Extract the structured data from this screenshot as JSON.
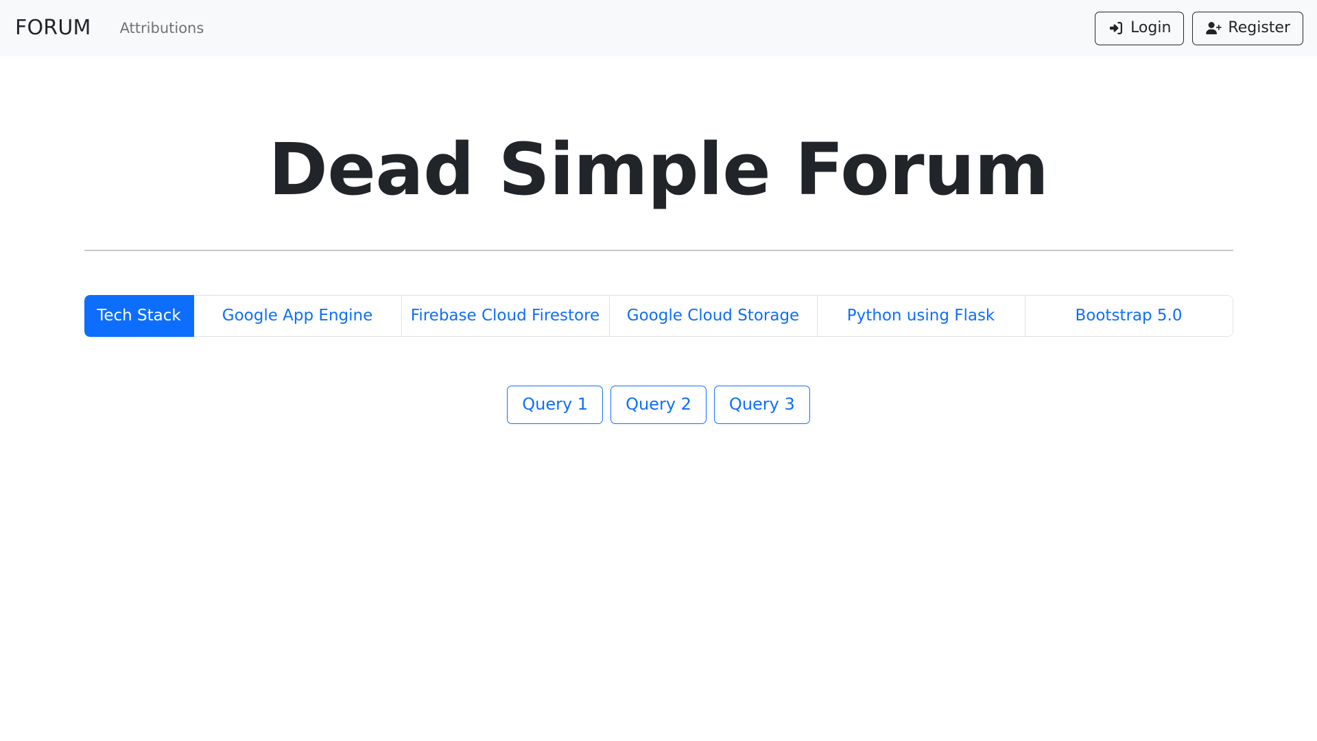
{
  "navbar": {
    "brand": "FORUM",
    "links": [
      {
        "label": "Attributions",
        "name": "nav-link-attributions"
      }
    ],
    "login_button": {
      "label": "Login",
      "icon": "sign-in-icon"
    },
    "register_button": {
      "label": "Register",
      "icon": "user-plus-icon"
    },
    "background_color": "#f8f9fa"
  },
  "main": {
    "title": "Dead Simple Forum",
    "tabs": [
      {
        "label": "Tech Stack",
        "active": true
      },
      {
        "label": "Google App Engine",
        "active": false
      },
      {
        "label": "Firebase Cloud Firestore",
        "active": false
      },
      {
        "label": "Google Cloud Storage",
        "active": false
      },
      {
        "label": "Python using Flask",
        "active": false
      },
      {
        "label": "Bootstrap 5.0",
        "active": false
      }
    ],
    "query_buttons": [
      {
        "label": "Query 1"
      },
      {
        "label": "Query 2"
      },
      {
        "label": "Query 3"
      }
    ]
  },
  "colors": {
    "primary": "#0d6efd",
    "dark": "#212529",
    "light": "#f8f9fa",
    "border": "#dee2e6",
    "divider": "#c9c9c9",
    "muted": "rgba(0,0,0,0.55)"
  }
}
